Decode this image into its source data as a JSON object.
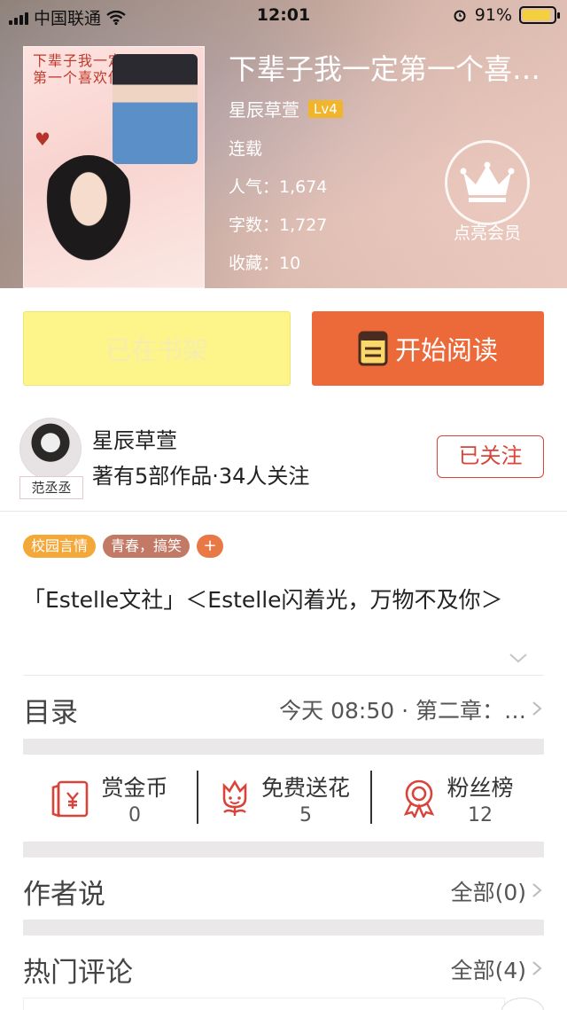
{
  "status_bar": {
    "carrier": "中国联通",
    "time": "12:01",
    "battery": "91%",
    "battery_level": 0.91
  },
  "book": {
    "cover_text": "下辈子我一定第一个喜欢你",
    "title": "下辈子我一定第一个喜欢你",
    "author": "星辰草萱",
    "level": "Lv4",
    "status": "连载",
    "popularity": "人气：1,674",
    "word_count": "字数：1,727",
    "favorites": "收藏：10"
  },
  "vip": {
    "label": "点亮会员"
  },
  "actions": {
    "shelf_label": "已在书架",
    "read_label": "开始阅读"
  },
  "author_card": {
    "name": "星辰草萱",
    "avatar_tag": "范丞丞",
    "meta": "著有5部作品·34人关注",
    "follow_label": "已关注"
  },
  "tags": [
    "校园言情",
    "青春，搞笑",
    "+"
  ],
  "intro": "「Estelle文社」＜Estelle闪着光，万物不及你＞",
  "catalog": {
    "label": "目录",
    "value": "今天 08:50 · 第二章：…"
  },
  "rewards": [
    {
      "label": "赏金币",
      "count": "0",
      "icon": "red-envelope-icon"
    },
    {
      "label": "免费送花",
      "count": "5",
      "icon": "flower-icon"
    },
    {
      "label": "粉丝榜",
      "count": "12",
      "icon": "medal-icon"
    }
  ],
  "author_says": {
    "label": "作者说",
    "value": "全部(0)"
  },
  "hot_comments": {
    "label": "热门评论",
    "value": "全部(4)"
  },
  "colors": {
    "accent": "#ec6a3a",
    "shelf_button": "#fdf48a",
    "follow": "#d9443a",
    "level_badge": "#f0b52a"
  }
}
